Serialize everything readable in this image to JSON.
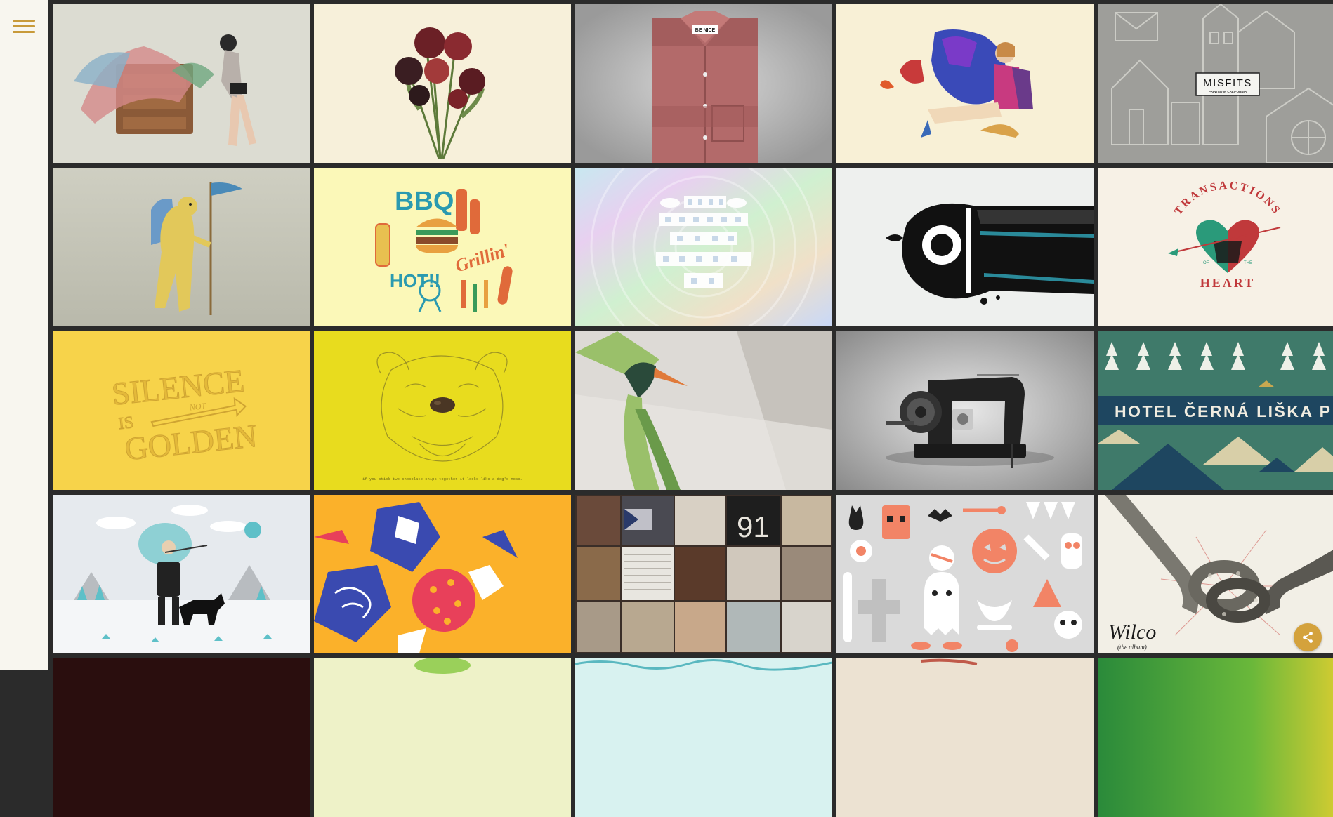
{
  "sidebar": {
    "menu_icon": "hamburger-menu-icon"
  },
  "share": {
    "icon": "share-icon",
    "color": "#d4a23c"
  },
  "accent": "#c89a3a",
  "tiles": {
    "shirt_tag": "BE NICE",
    "misfits_title": "MISFITS",
    "misfits_subtitle": "PAINTED IN CALIFORNIA",
    "bbq_word": "BBQ",
    "hot_word": "HOT!!",
    "grillin_word": "Grillin'",
    "transactions_top": "TRANSACTIONS",
    "transactions_of": "OF",
    "transactions_the": "THE",
    "transactions_bottom": "HEART",
    "silence_line1": "SILENCE",
    "silence_is": "IS",
    "silence_not": "NOT",
    "silence_line2": "GOLDEN",
    "bulldog_caption": "if you stick two chocolate chips together it looks like a dog's nose.",
    "hotel_name": "HOTEL ČERNÁ LIŠKA PRAHA",
    "photo_number": "91",
    "wilco_signature": "Wilco",
    "wilco_subtitle": "(the album)"
  }
}
